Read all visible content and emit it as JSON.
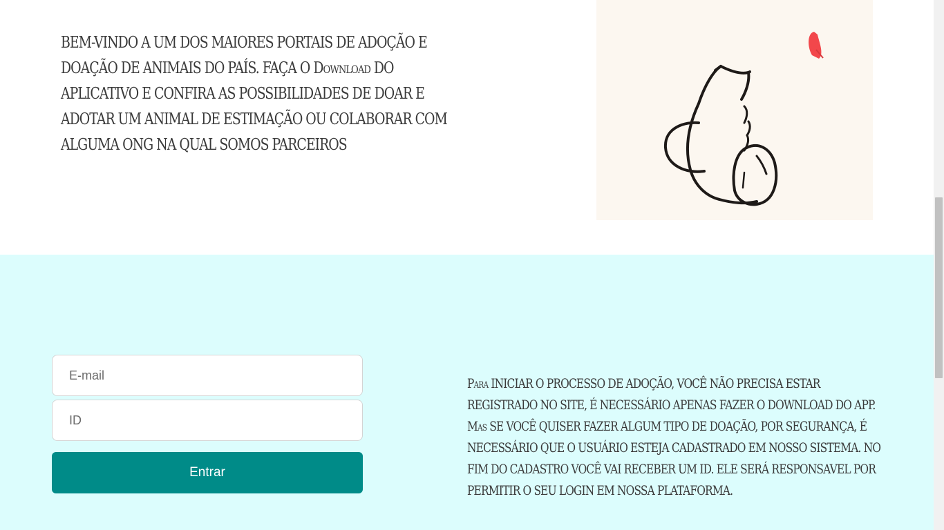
{
  "intro": {
    "text": "BEM-VINDO A UM DOS MAIORES PORTAIS DE ADOÇÃO E DOAÇÃO DE ANIMAIS DO PAÍS. FAÇA O Download DO APLICATIVO E CONFIRA AS POSSIBILIDADES DE DOAR E ADOTAR UM ANIMAL DE ESTIMAÇÃO OU COLABORAR COM ALGUMA ONG NA QUAL SOMOS PARCEIROS",
    "image_icon": "cat-and-butterfly-illustration"
  },
  "login": {
    "email_placeholder": "E-mail",
    "id_placeholder": "ID",
    "submit_label": "Entrar"
  },
  "info": {
    "text": "Para INICIAR O PROCESSO DE ADOÇÃO, VOCÊ NÃO PRECISA ESTAR REGISTRADO NO SITE, É NECESSÁRIO APENAS FAZER O DOWNLOAD DO APP. Mas SE VOCÊ QUISER FAZER ALGUM TIPO DE DOAÇÃO, POR SEGURANÇA, É NECESSÁRIO QUE O USUÁRIO ESTEJA CADASTRADO EM NOSSO SISTEMA. NO FIM DO CADASTRO VOCÊ VAI RECEBER UM ID. ELE SERÁ RESPONSAVEL POR PERMITIR O SEU LOGIN EM NOSSA PLATAFORMA."
  },
  "colors": {
    "login_background": "#dcfdfd",
    "button_teal": "#008b88",
    "image_background": "#fcf7f0",
    "butterfly_red": "#f2474b"
  }
}
